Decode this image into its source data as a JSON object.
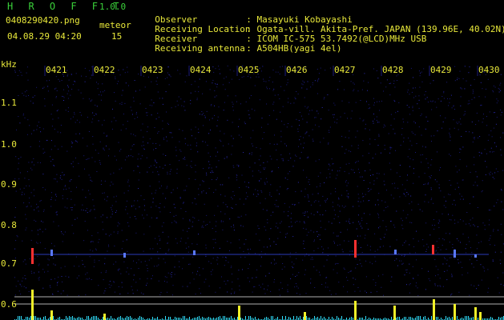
{
  "header": {
    "title": "H R O F F T",
    "version": "1.0.0",
    "filename": "0408290420.png",
    "timestamp": "04.08.29 04:20",
    "meteor_label": "meteor",
    "meteor_count": "15"
  },
  "info": [
    {
      "label": "Observer",
      "value": "Masayuki Kobayashi"
    },
    {
      "label": "Receiving Location",
      "value": "Ogata-vill. Akita-Pref. JAPAN (139.96E, 40.02N)"
    },
    {
      "label": "Receiver",
      "value": "ICOM IC-575 53.7492(@LCD)MHz USB"
    },
    {
      "label": "Receiving antenna",
      "value": "A504HB(yagi 4el)"
    }
  ],
  "axis": {
    "unit": "kHz",
    "time_labels": [
      "0421",
      "0422",
      "0423",
      "0424",
      "0425",
      "0426",
      "0427",
      "0428",
      "0429",
      "0430"
    ],
    "freq_labels": [
      "1.1",
      "1.0",
      "0.9",
      "0.8",
      "0.7",
      "0.6"
    ]
  },
  "colors": {
    "text": "#e8e83a",
    "title": "#3ad03a",
    "background": "#000000",
    "noise": "#1a1a78",
    "echo_red": "#ff3030",
    "echo_blue": "#5a78ff",
    "bar_cyan": "#30e0ff",
    "bar_yellow": "#f0f028"
  }
}
